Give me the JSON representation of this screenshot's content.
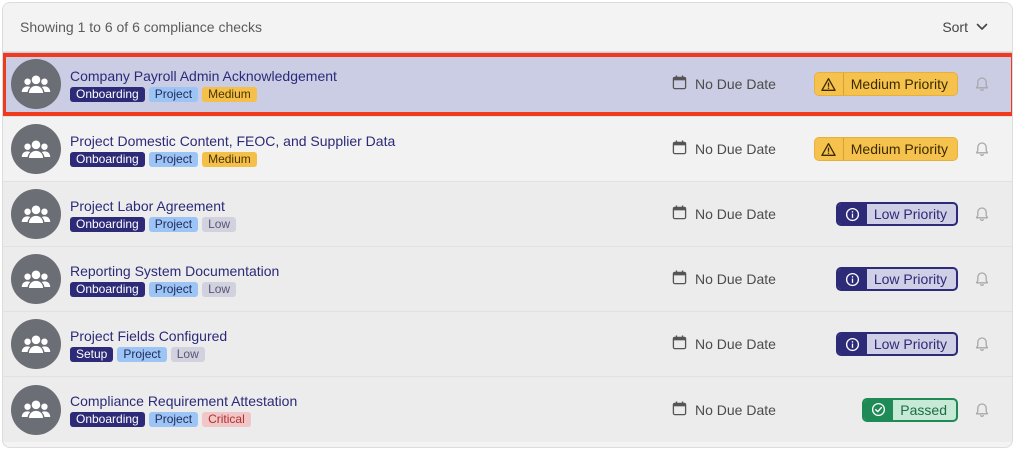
{
  "header": {
    "summary": "Showing 1 to 6 of 6 compliance checks",
    "sort_label": "Sort"
  },
  "colors": {
    "accent": "#2d2a78",
    "medium": "#f5c34d",
    "passed": "#1e8a56",
    "highlight": "#f03a1c"
  },
  "rows": [
    {
      "title": "Company Payroll Admin Acknowledgement",
      "category": "Onboarding",
      "type": "Project",
      "priority_tag": "Medium",
      "due": "No Due Date",
      "status": "Medium Priority",
      "status_icon": "warning-icon"
    },
    {
      "title": "Project Domestic Content, FEOC, and Supplier Data",
      "category": "Onboarding",
      "type": "Project",
      "priority_tag": "Medium",
      "due": "No Due Date",
      "status": "Medium Priority",
      "status_icon": "warning-icon"
    },
    {
      "title": "Project Labor Agreement",
      "category": "Onboarding",
      "type": "Project",
      "priority_tag": "Low",
      "due": "No Due Date",
      "status": "Low Priority",
      "status_icon": "info-icon"
    },
    {
      "title": "Reporting System Documentation",
      "category": "Onboarding",
      "type": "Project",
      "priority_tag": "Low",
      "due": "No Due Date",
      "status": "Low Priority",
      "status_icon": "info-icon"
    },
    {
      "title": "Project Fields Configured",
      "category": "Setup",
      "type": "Project",
      "priority_tag": "Low",
      "due": "No Due Date",
      "status": "Low Priority",
      "status_icon": "info-icon"
    },
    {
      "title": "Compliance Requirement Attestation",
      "category": "Onboarding",
      "type": "Project",
      "priority_tag": "Critical",
      "due": "No Due Date",
      "status": "Passed",
      "status_icon": "check-circle-icon"
    }
  ]
}
